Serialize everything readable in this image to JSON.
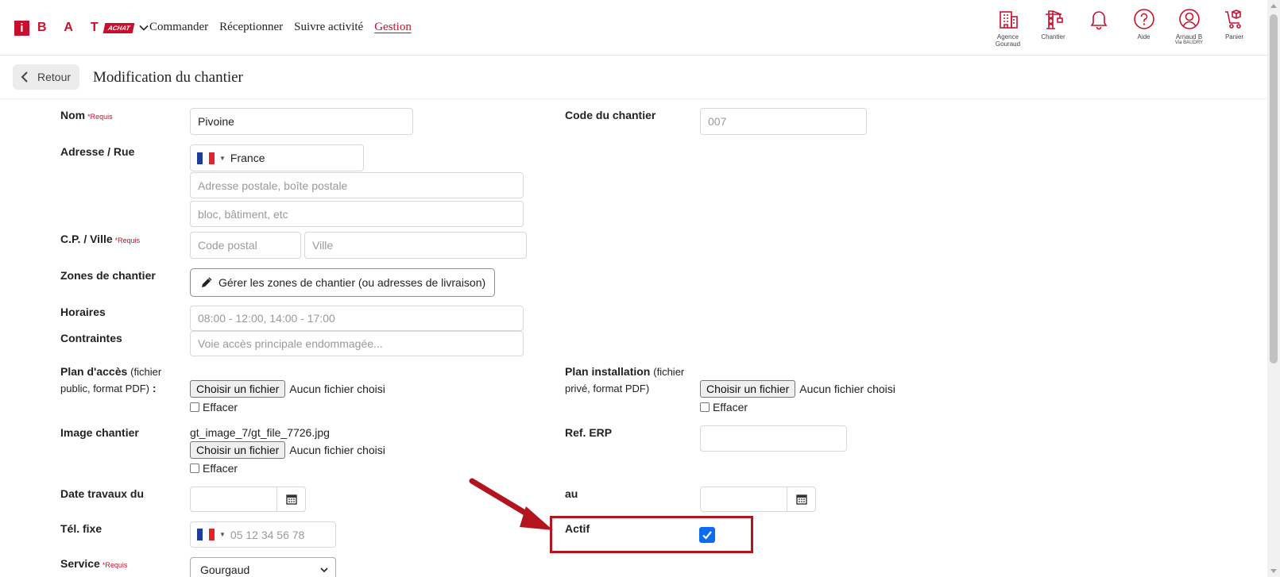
{
  "navbar": {
    "logo": {
      "letter": "i",
      "word": "B A T",
      "badge": "ACHAT"
    },
    "links": [
      {
        "label": "Commander",
        "active": false
      },
      {
        "label": "Réceptionner",
        "active": false
      },
      {
        "label": "Suivre activité",
        "active": false
      },
      {
        "label": "Gestion",
        "active": true
      }
    ],
    "icons": [
      {
        "name": "building-icon",
        "label": "Agence",
        "sub": "Gouraud"
      },
      {
        "name": "crane-icon",
        "label": "Chantier",
        "sub": ""
      },
      {
        "name": "bell-icon",
        "label": "",
        "sub": ""
      },
      {
        "name": "help-icon",
        "label": "Aide",
        "sub": ""
      },
      {
        "name": "user-icon",
        "label": "Arnaud B",
        "sub": "Via BAUDRY"
      },
      {
        "name": "cart-icon",
        "label": "Panier",
        "sub": ""
      }
    ],
    "accent_color": "#c8102e"
  },
  "titlebar": {
    "back_label": "Retour",
    "title": "Modification du chantier"
  },
  "form": {
    "nom": {
      "label": "Nom",
      "required": "*Requis",
      "value": "Pivoine"
    },
    "code": {
      "label": "Code du chantier",
      "placeholder": "007"
    },
    "adresse": {
      "label": "Adresse / Rue",
      "country": "France",
      "line1_placeholder": "Adresse postale, boîte postale",
      "line2_placeholder": "bloc, bâtiment, etc"
    },
    "cp_ville": {
      "label": "C.P. / Ville",
      "required": "*Requis",
      "cp_placeholder": "Code postal",
      "ville_placeholder": "Ville"
    },
    "zones": {
      "label": "Zones de chantier",
      "button": "Gérer les zones de chantier (ou adresses de livraison)"
    },
    "horaires": {
      "label": "Horaires",
      "placeholder": "08:00 - 12:00, 14:00 - 17:00"
    },
    "contraintes": {
      "label": "Contraintes",
      "placeholder": "Voie accès principale endommagée..."
    },
    "plan_acces": {
      "label": "Plan d'accès",
      "hint_1": "(fichier",
      "hint_2": "public, format PDF)",
      "colon": ":",
      "file_button": "Choisir un fichier",
      "file_status": "Aucun fichier choisi",
      "clear": "Effacer"
    },
    "plan_installation": {
      "label": "Plan installation",
      "hint_1": "(fichier",
      "hint_2": "privé, format PDF)",
      "file_button": "Choisir un fichier",
      "file_status": "Aucun fichier choisi",
      "clear": "Effacer"
    },
    "image": {
      "label": "Image chantier",
      "current_file": "gt_image_7/gt_file_7726.jpg",
      "file_button": "Choisir un fichier",
      "file_status": "Aucun fichier choisi",
      "clear": "Effacer"
    },
    "ref_erp": {
      "label": "Ref. ERP",
      "value": ""
    },
    "date_du": {
      "label": "Date travaux du",
      "value": ""
    },
    "date_au": {
      "label": "au",
      "value": ""
    },
    "tel": {
      "label": "Tél. fixe",
      "placeholder": "05 12 34 56 78"
    },
    "actif": {
      "label": "Actif",
      "checked": true
    },
    "service": {
      "label": "Service",
      "required": "*Requis",
      "value": "Gourgaud"
    }
  },
  "annotation": {
    "color": "#b3141e"
  }
}
